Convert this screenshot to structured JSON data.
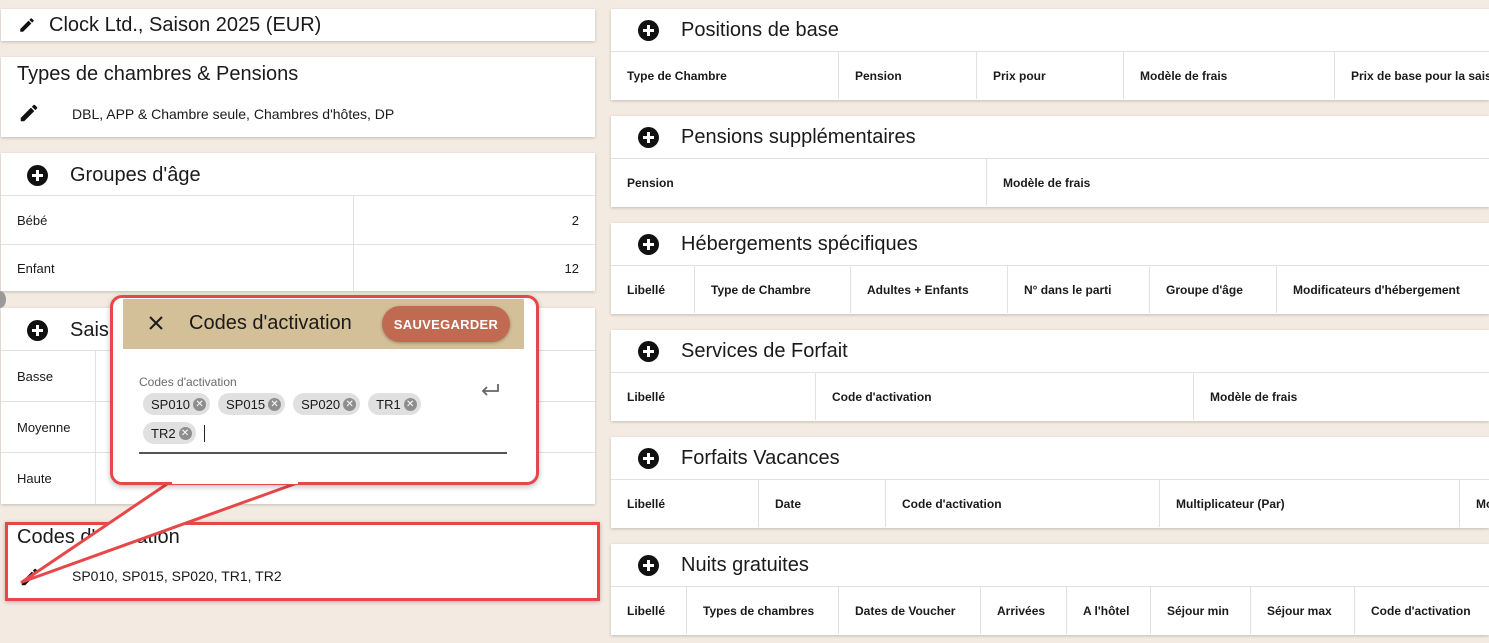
{
  "contract": {
    "title": "Clock Ltd., Saison 2025 (EUR)"
  },
  "room_types": {
    "title": "Types de chambres & Pensions",
    "value": "DBL, APP & Chambre seule, Chambres d'hôtes, DP"
  },
  "age_groups": {
    "title": "Groupes d'âge",
    "rows": [
      {
        "label": "Bébé",
        "value": "2"
      },
      {
        "label": "Enfant",
        "value": "12"
      }
    ]
  },
  "seasons": {
    "title_partial": "Sais",
    "rows": [
      {
        "label": "Basse"
      },
      {
        "label": "Moyenne"
      },
      {
        "label": "Haute"
      }
    ]
  },
  "activation_codes": {
    "title": "Codes d'activation",
    "value": "SP010, SP015, SP020, TR1, TR2"
  },
  "dialog": {
    "title": "Codes d'activation",
    "save_label": "SAUVEGARDER",
    "field_label": "Codes d'activation",
    "chips": [
      "SP010",
      "SP015",
      "SP020",
      "TR1",
      "TR2"
    ],
    "close_icon": "close-icon",
    "enter_icon": "return-icon"
  },
  "sections": {
    "base_positions": {
      "title": "Positions de base",
      "columns": [
        "Type de Chambre",
        "Pension",
        "Prix pour",
        "Modèle de frais",
        "Prix de base pour la saiso"
      ]
    },
    "extra_boards": {
      "title": "Pensions supplémentaires",
      "columns": [
        "Pension",
        "Modèle de frais"
      ]
    },
    "specific_accommodations": {
      "title": "Hébergements spécifiques",
      "columns": [
        "Libellé",
        "Type de Chambre",
        "Adultes + Enfants",
        "N° dans le parti",
        "Groupe d'âge",
        "Modificateurs d'hébergement"
      ]
    },
    "package_services": {
      "title": "Services de Forfait",
      "columns": [
        "Libellé",
        "Code d'activation",
        "Modèle de frais"
      ]
    },
    "holiday_packages": {
      "title": "Forfaits Vacances",
      "columns": [
        "Libellé",
        "Date",
        "Code d'activation",
        "Multiplicateur (Par)",
        "Mo"
      ]
    },
    "free_nights": {
      "title": "Nuits gratuites",
      "columns": [
        "Libellé",
        "Types de chambres",
        "Dates de Voucher",
        "Arrivées",
        "A l'hôtel",
        "Séjour min",
        "Séjour max",
        "Code d'activation"
      ]
    }
  },
  "colors": {
    "background": "#f3ebe1",
    "dialog_header": "#d4c098",
    "save_button": "#c06a51",
    "highlight": "#e8474a"
  }
}
